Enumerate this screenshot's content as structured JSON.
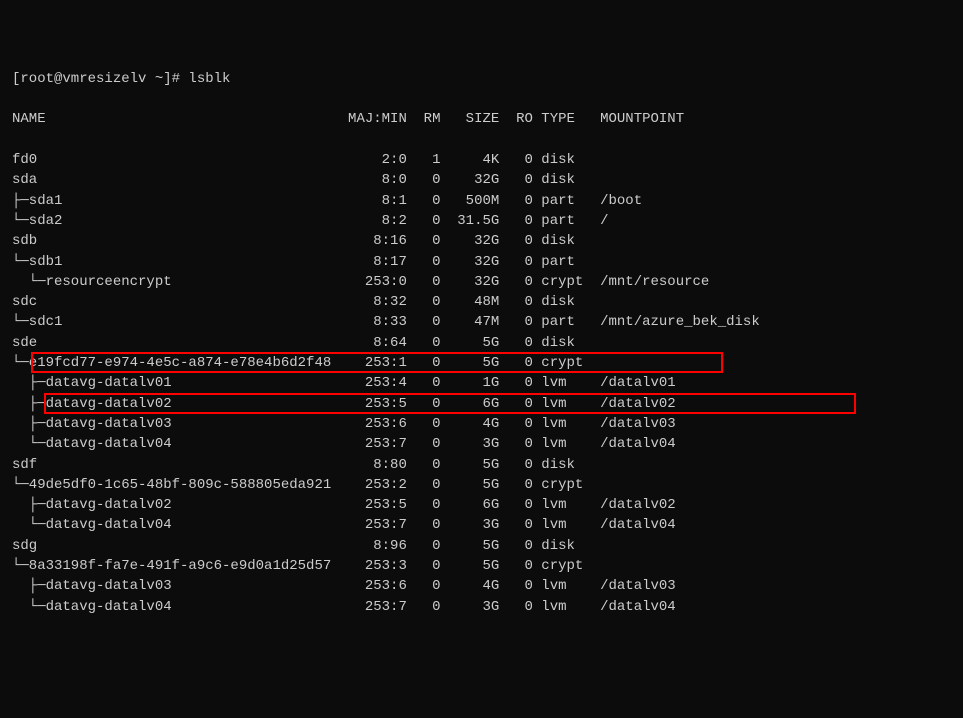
{
  "prompt": "[root@vmresizelv ~]# lsblk",
  "header": {
    "name": "NAME",
    "majmin": "MAJ:MIN",
    "rm": "RM",
    "size": "SIZE",
    "ro": "RO",
    "type": "TYPE",
    "mountpoint": "MOUNTPOINT"
  },
  "rows": [
    {
      "tree": "",
      "name": "fd0",
      "majmin": "2:0",
      "rm": "1",
      "size": "4K",
      "ro": "0",
      "type": "disk",
      "mountpoint": ""
    },
    {
      "tree": "",
      "name": "sda",
      "majmin": "8:0",
      "rm": "0",
      "size": "32G",
      "ro": "0",
      "type": "disk",
      "mountpoint": ""
    },
    {
      "tree": "├─",
      "name": "sda1",
      "majmin": "8:1",
      "rm": "0",
      "size": "500M",
      "ro": "0",
      "type": "part",
      "mountpoint": "/boot"
    },
    {
      "tree": "└─",
      "name": "sda2",
      "majmin": "8:2",
      "rm": "0",
      "size": "31.5G",
      "ro": "0",
      "type": "part",
      "mountpoint": "/"
    },
    {
      "tree": "",
      "name": "sdb",
      "majmin": "8:16",
      "rm": "0",
      "size": "32G",
      "ro": "0",
      "type": "disk",
      "mountpoint": ""
    },
    {
      "tree": "└─",
      "name": "sdb1",
      "majmin": "8:17",
      "rm": "0",
      "size": "32G",
      "ro": "0",
      "type": "part",
      "mountpoint": ""
    },
    {
      "tree": "  └─",
      "name": "resourceencrypt",
      "majmin": "253:0",
      "rm": "0",
      "size": "32G",
      "ro": "0",
      "type": "crypt",
      "mountpoint": "/mnt/resource"
    },
    {
      "tree": "",
      "name": "sdc",
      "majmin": "8:32",
      "rm": "0",
      "size": "48M",
      "ro": "0",
      "type": "disk",
      "mountpoint": ""
    },
    {
      "tree": "└─",
      "name": "sdc1",
      "majmin": "8:33",
      "rm": "0",
      "size": "47M",
      "ro": "0",
      "type": "part",
      "mountpoint": "/mnt/azure_bek_disk"
    },
    {
      "tree": "",
      "name": "sde",
      "majmin": "8:64",
      "rm": "0",
      "size": "5G",
      "ro": "0",
      "type": "disk",
      "mountpoint": ""
    },
    {
      "tree": "└─",
      "name": "e19fcd77-e974-4e5c-a874-e78e4b6d2f48",
      "majmin": "253:1",
      "rm": "0",
      "size": "5G",
      "ro": "0",
      "type": "crypt",
      "mountpoint": "",
      "highlight": 1
    },
    {
      "tree": "  ├─",
      "name": "datavg-datalv01",
      "majmin": "253:4",
      "rm": "0",
      "size": "1G",
      "ro": "0",
      "type": "lvm",
      "mountpoint": "/datalv01"
    },
    {
      "tree": "  ├─",
      "name": "datavg-datalv02",
      "majmin": "253:5",
      "rm": "0",
      "size": "6G",
      "ro": "0",
      "type": "lvm",
      "mountpoint": "/datalv02",
      "highlight": 2
    },
    {
      "tree": "  ├─",
      "name": "datavg-datalv03",
      "majmin": "253:6",
      "rm": "0",
      "size": "4G",
      "ro": "0",
      "type": "lvm",
      "mountpoint": "/datalv03"
    },
    {
      "tree": "  └─",
      "name": "datavg-datalv04",
      "majmin": "253:7",
      "rm": "0",
      "size": "3G",
      "ro": "0",
      "type": "lvm",
      "mountpoint": "/datalv04"
    },
    {
      "tree": "",
      "name": "sdf",
      "majmin": "8:80",
      "rm": "0",
      "size": "5G",
      "ro": "0",
      "type": "disk",
      "mountpoint": ""
    },
    {
      "tree": "└─",
      "name": "49de5df0-1c65-48bf-809c-588805eda921",
      "majmin": "253:2",
      "rm": "0",
      "size": "5G",
      "ro": "0",
      "type": "crypt",
      "mountpoint": ""
    },
    {
      "tree": "  ├─",
      "name": "datavg-datalv02",
      "majmin": "253:5",
      "rm": "0",
      "size": "6G",
      "ro": "0",
      "type": "lvm",
      "mountpoint": "/datalv02"
    },
    {
      "tree": "  └─",
      "name": "datavg-datalv04",
      "majmin": "253:7",
      "rm": "0",
      "size": "3G",
      "ro": "0",
      "type": "lvm",
      "mountpoint": "/datalv04"
    },
    {
      "tree": "",
      "name": "sdg",
      "majmin": "8:96",
      "rm": "0",
      "size": "5G",
      "ro": "0",
      "type": "disk",
      "mountpoint": ""
    },
    {
      "tree": "└─",
      "name": "8a33198f-fa7e-491f-a9c6-e9d0a1d25d57",
      "majmin": "253:3",
      "rm": "0",
      "size": "5G",
      "ro": "0",
      "type": "crypt",
      "mountpoint": ""
    },
    {
      "tree": "  ├─",
      "name": "datavg-datalv03",
      "majmin": "253:6",
      "rm": "0",
      "size": "4G",
      "ro": "0",
      "type": "lvm",
      "mountpoint": "/datalv03"
    },
    {
      "tree": "  └─",
      "name": "datavg-datalv04",
      "majmin": "253:7",
      "rm": "0",
      "size": "3G",
      "ro": "0",
      "type": "lvm",
      "mountpoint": "/datalv04"
    }
  ],
  "col_widths": {
    "name": 40,
    "majmin": 7,
    "rm": 3,
    "size": 6,
    "ro": 3,
    "type": 6,
    "mountpoint": 0
  }
}
